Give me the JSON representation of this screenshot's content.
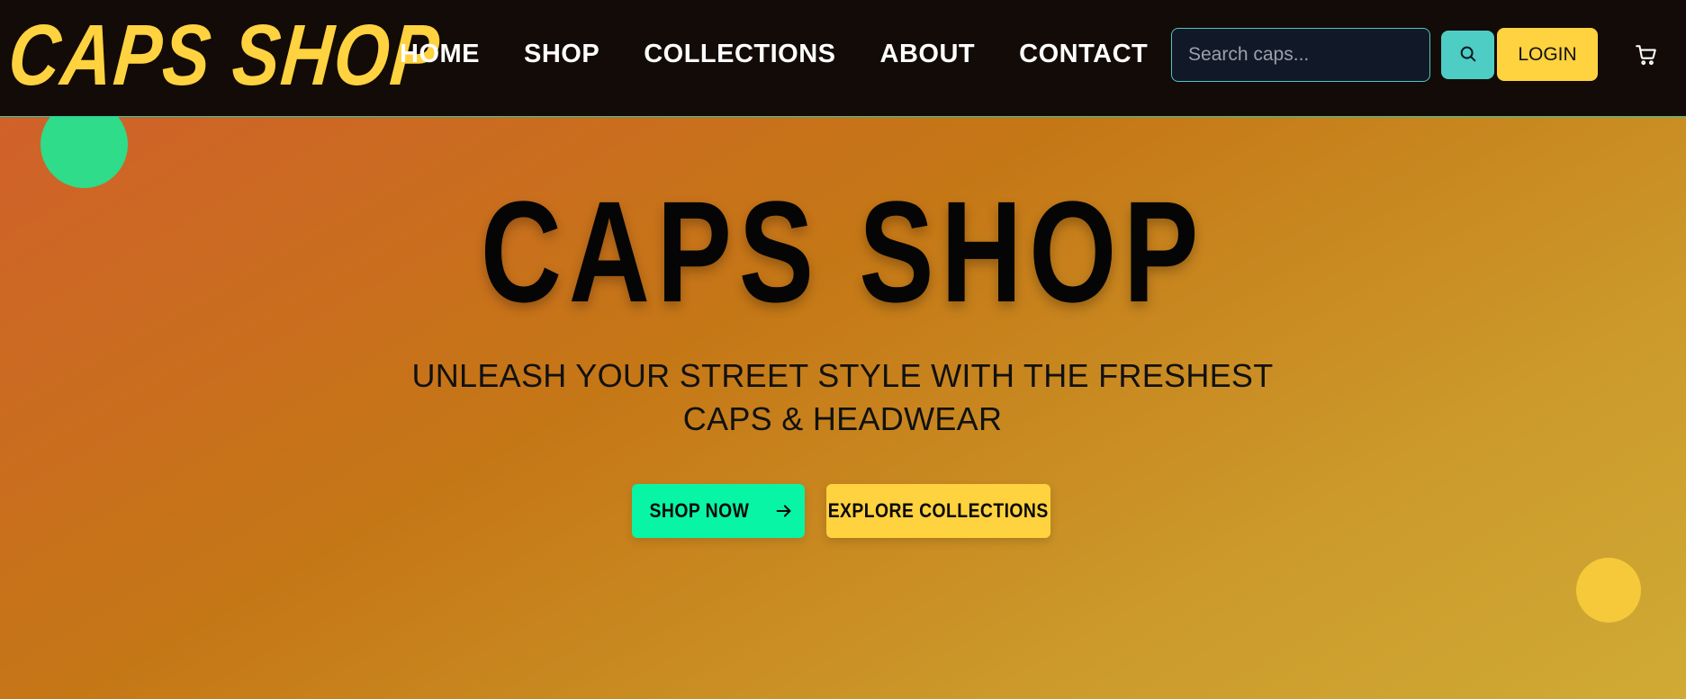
{
  "brand": {
    "logo_text": "CAPS SHOP"
  },
  "nav": {
    "items": [
      {
        "label": "HOME"
      },
      {
        "label": "SHOP"
      },
      {
        "label": "COLLECTIONS"
      },
      {
        "label": "ABOUT"
      },
      {
        "label": "CONTACT"
      }
    ]
  },
  "search": {
    "placeholder": "Search caps...",
    "value": "",
    "icon": "search-icon"
  },
  "header": {
    "login_label": "LOGIN",
    "cart_icon": "cart-icon"
  },
  "hero": {
    "title": "CAPS SHOP",
    "subtitle_line1": "UNLEASH YOUR STREET STYLE WITH THE FRESHEST",
    "subtitle_line2": "CAPS & HEADWEAR",
    "primary_button": {
      "label": "SHOP NOW",
      "icon": "arrow-right-icon"
    },
    "secondary_button": {
      "label": "EXPLORE COLLECTIONS"
    }
  },
  "colors": {
    "brand_yellow": "#ffd23f",
    "accent_teal": "#4ecdc4",
    "accent_green": "#08f5a5",
    "header_bg": "#130b07",
    "hero_orange": "#c57716"
  }
}
